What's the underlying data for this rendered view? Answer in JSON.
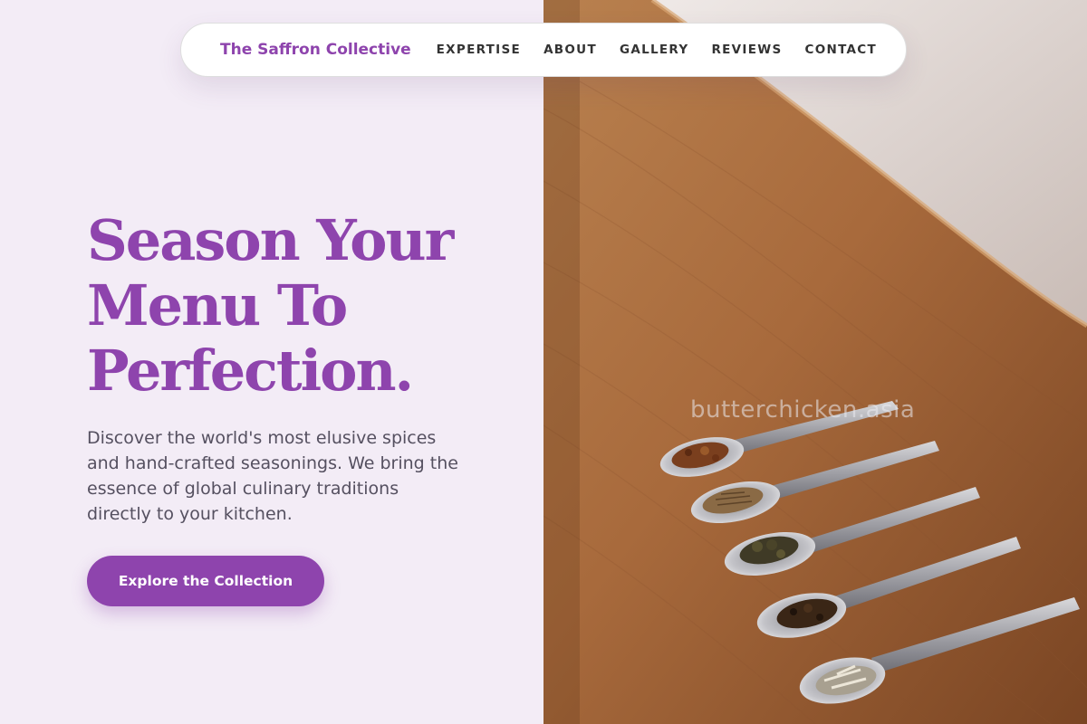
{
  "brand": {
    "name": "The Saffron Collective"
  },
  "nav": {
    "links": [
      {
        "label": "EXPERTISE"
      },
      {
        "label": "ABOUT"
      },
      {
        "label": "GALLERY"
      },
      {
        "label": "REVIEWS"
      },
      {
        "label": "CONTACT"
      }
    ]
  },
  "hero": {
    "title_lines": [
      "Season Your",
      "Menu To",
      "Perfection."
    ],
    "subtitle": "Discover the world's most elusive spices and hand-crafted seasonings. We bring the essence of global culinary traditions directly to your kitchen.",
    "cta_label": "Explore the Collection"
  },
  "image": {
    "description_icon": "spice-spoons-photo-image",
    "watermark": "butterchicken.asia"
  },
  "colors": {
    "accent": "#8e44ad",
    "left_background": "#f3ecf6",
    "nav_text": "#333333",
    "body_text": "#555060"
  }
}
